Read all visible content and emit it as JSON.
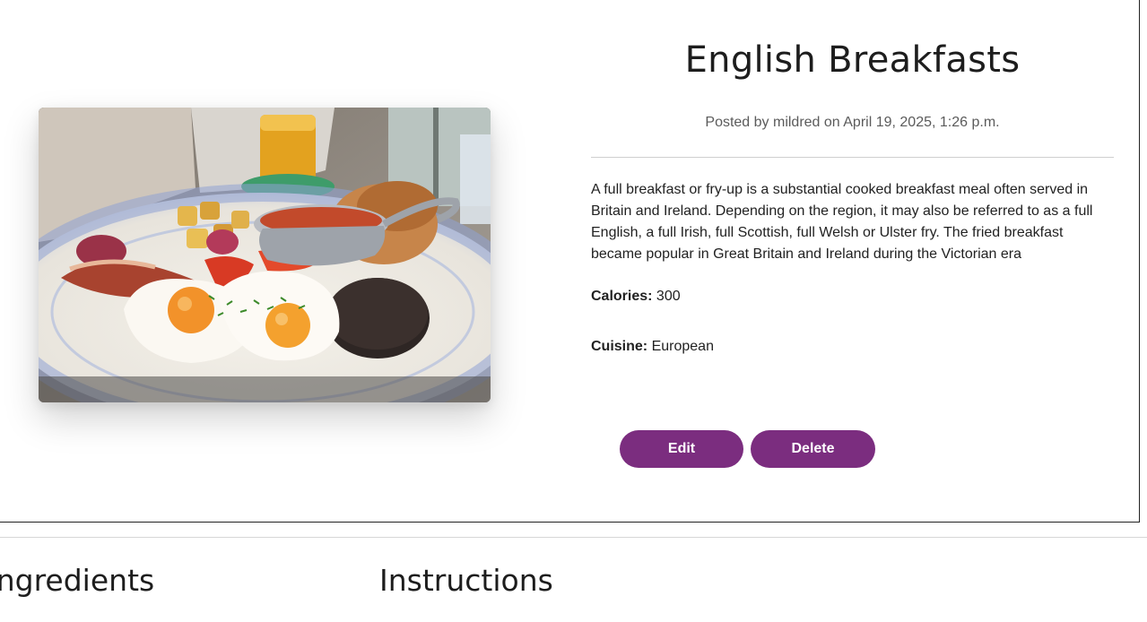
{
  "recipe": {
    "title": "English Breakfasts",
    "meta": "Posted by mildred on April 19, 2025, 1:26 p.m.",
    "description": "A full breakfast or fry-up is a substantial cooked breakfast meal often served in Britain and Ireland. Depending on the region, it may also be referred to as a full English, a full Irish, full Scottish, full Welsh or Ulster fry. The fried breakfast became popular in Great Britain and Ireland during the Victorian era",
    "calories_label": "Calories:",
    "calories_value": "300",
    "cuisine_label": "Cuisine:",
    "cuisine_value": "European"
  },
  "actions": {
    "edit_label": "Edit",
    "delete_label": "Delete",
    "accent_color": "#7b2d7f"
  },
  "sections": {
    "ingredients_heading": "Ingredients",
    "instructions_heading": "Instructions"
  },
  "image": {
    "subject": "breakfast-plate-photo"
  }
}
